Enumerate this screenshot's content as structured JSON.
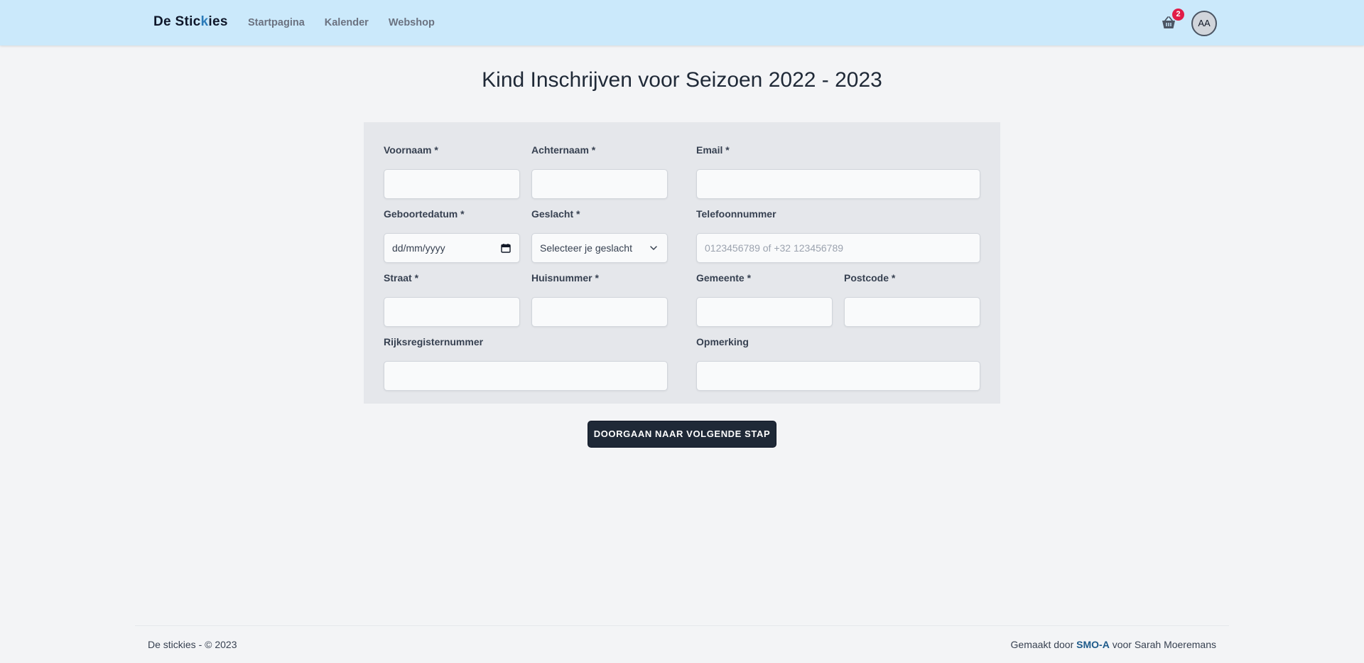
{
  "header": {
    "logo_part1": "De Stic",
    "logo_accent": "k",
    "logo_part2": "ies",
    "nav": [
      "Startpagina",
      "Kalender",
      "Webshop"
    ],
    "cart_count": "2",
    "avatar_initials": "AA"
  },
  "page": {
    "title": "Kind Inschrijven voor Seizoen 2022 - 2023"
  },
  "form": {
    "voornaam": {
      "label": "Voornaam *",
      "value": ""
    },
    "achternaam": {
      "label": "Achternaam *",
      "value": ""
    },
    "email": {
      "label": "Email *",
      "value": ""
    },
    "geboortedatum": {
      "label": "Geboortedatum *",
      "value": "dd/mm/yyyy"
    },
    "geslacht": {
      "label": "Geslacht *",
      "value": "Selecteer je geslacht"
    },
    "telefoon": {
      "label": "Telefoonnummer",
      "placeholder": "0123456789 of +32 123456789"
    },
    "straat": {
      "label": "Straat *",
      "value": ""
    },
    "huisnummer": {
      "label": "Huisnummer *",
      "value": ""
    },
    "gemeente": {
      "label": "Gemeente *",
      "value": ""
    },
    "postcode": {
      "label": "Postcode *",
      "value": ""
    },
    "rijksregisternummer": {
      "label": "Rijksregisternummer",
      "value": ""
    },
    "opmerking": {
      "label": "Opmerking",
      "value": ""
    }
  },
  "actions": {
    "next_label": "DOORGAAN NAAR VOLGENDE STAP"
  },
  "footer": {
    "left": "De stickies - © 2023",
    "right_prefix": "Gemaakt door ",
    "right_brand": "SMO-A",
    "right_suffix": " voor Sarah Moeremans"
  },
  "colors": {
    "header_bg": "#cbe9fb",
    "page_bg": "#f3f4f6",
    "card_bg": "#e5e7eb",
    "button_bg": "#1f2937",
    "badge": "#e11d48",
    "brand_link": "#1e5a8a"
  },
  "icons": {
    "cart": "shopping-basket-icon",
    "select": "chevron-down-icon",
    "date": "calendar-icon"
  }
}
